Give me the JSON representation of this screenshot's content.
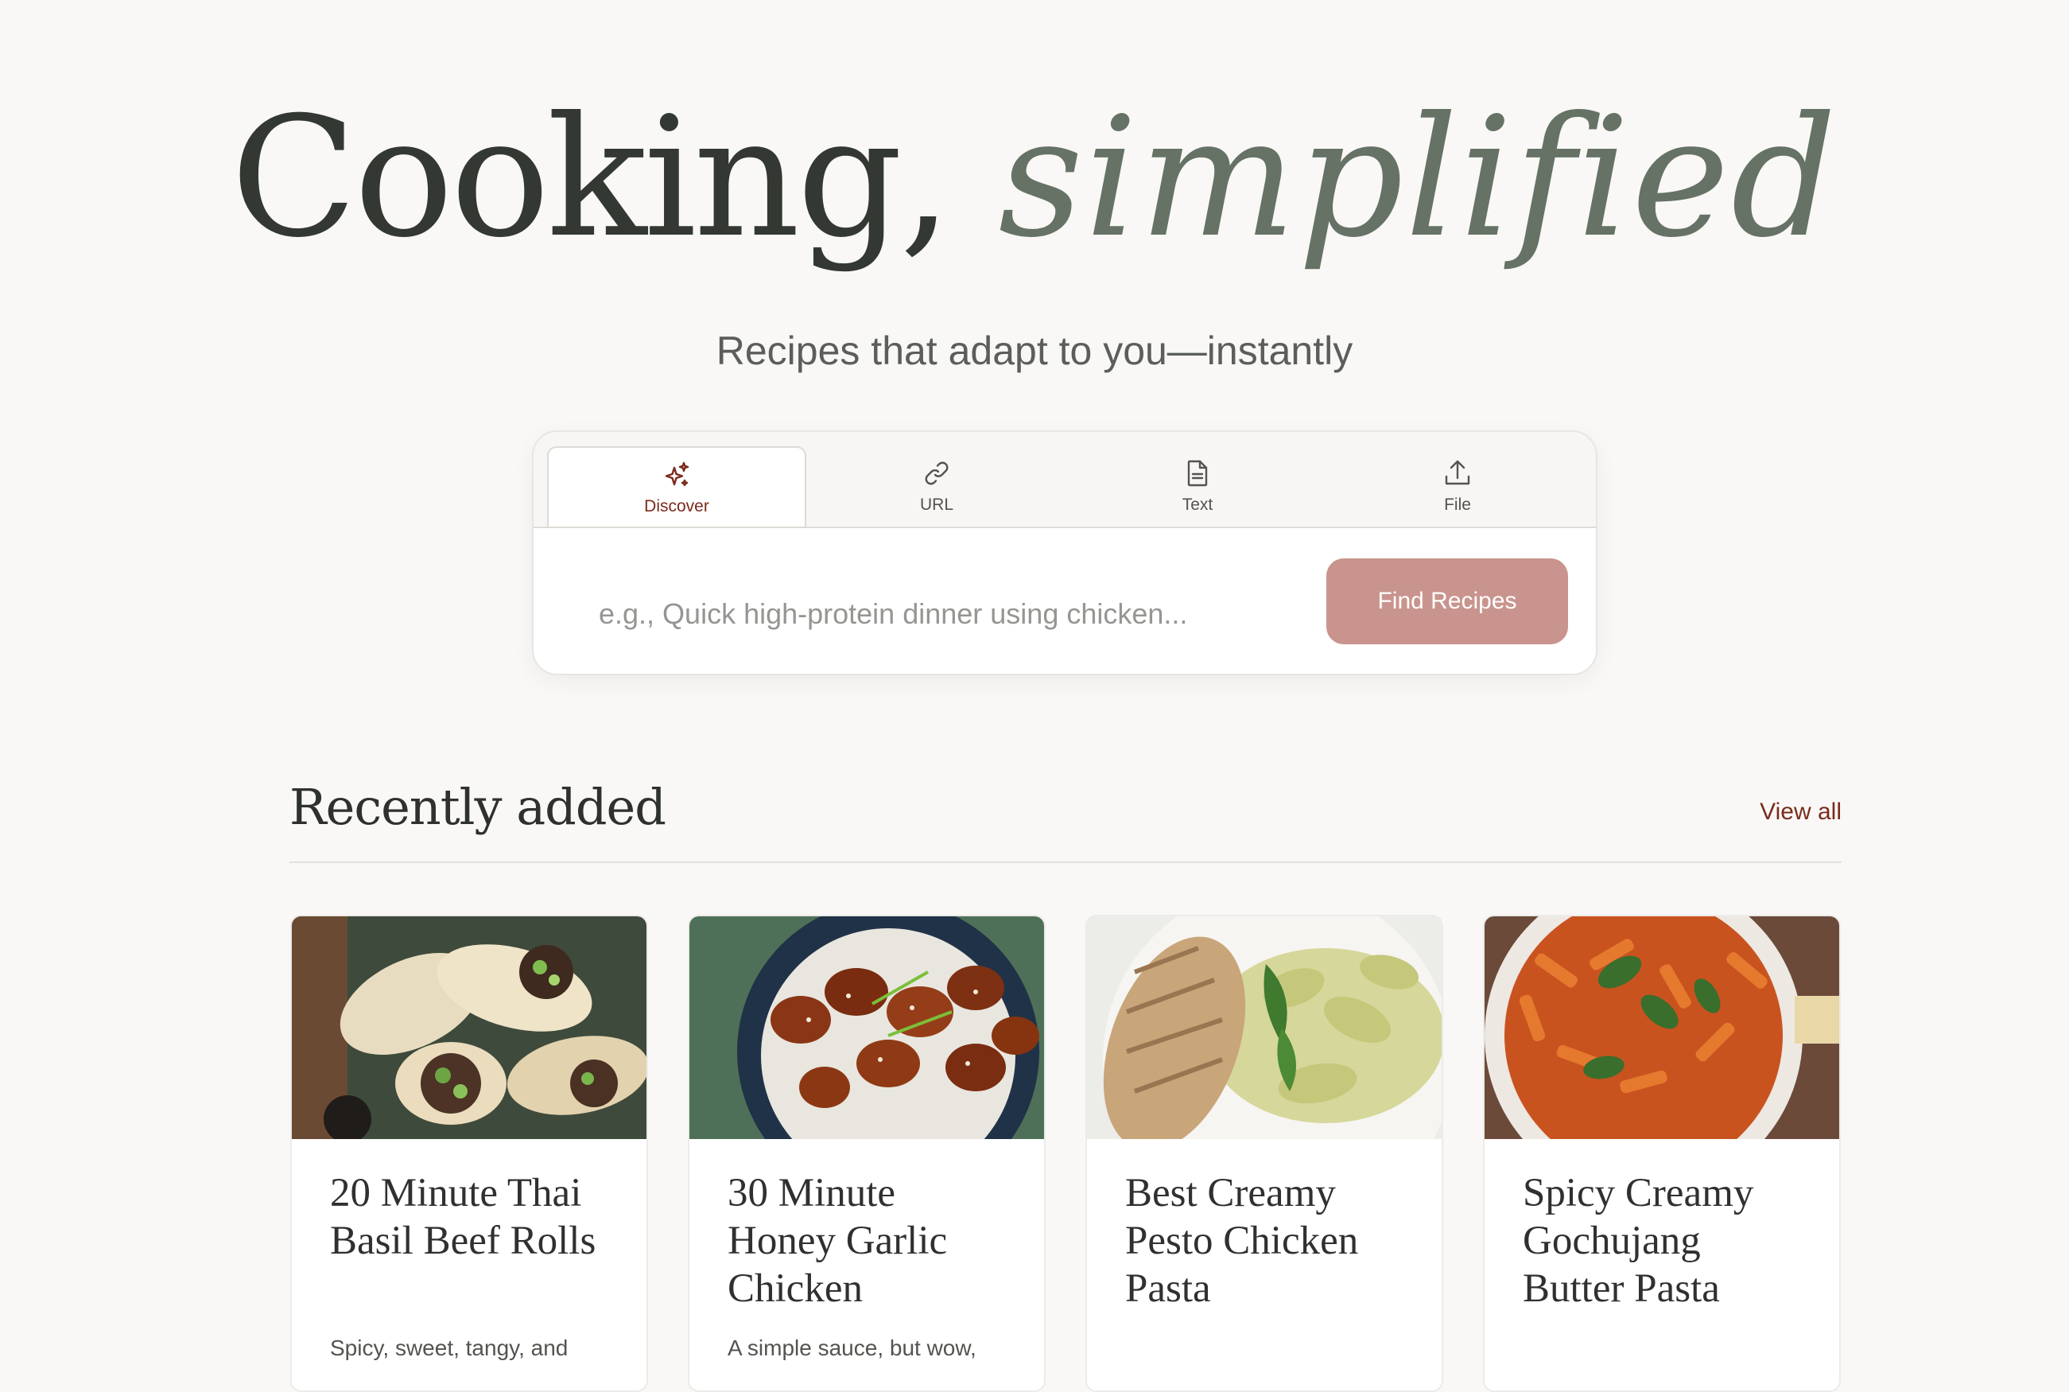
{
  "hero": {
    "title_plain": "Cooking,",
    "title_italic": "simplified",
    "subtitle": "Recipes that adapt to you—instantly"
  },
  "search": {
    "tabs": [
      {
        "label": "Discover",
        "icon": "sparkles-icon",
        "active": true
      },
      {
        "label": "URL",
        "icon": "link-icon",
        "active": false
      },
      {
        "label": "Text",
        "icon": "document-icon",
        "active": false
      },
      {
        "label": "File",
        "icon": "upload-icon",
        "active": false
      }
    ],
    "placeholder": "e.g., Quick high-protein dinner using chicken...",
    "value": "",
    "button_label": "Find Recipes"
  },
  "recent": {
    "title": "Recently added",
    "view_all": "View all",
    "cards": [
      {
        "title": "20 Minute Thai Basil Beef Rolls",
        "description": "Spicy, sweet, tangy, and"
      },
      {
        "title": "30 Minute Honey Garlic Chicken",
        "description": "A simple sauce, but wow,"
      },
      {
        "title": "Best Creamy Pesto Chicken Pasta",
        "description": ""
      },
      {
        "title": "Spicy Creamy Gochujang Butter Pasta",
        "description": ""
      }
    ]
  },
  "colors": {
    "background": "#f9f8f6",
    "accent": "#7a2b1c",
    "button": "#c9948d",
    "title_dark": "#333833",
    "title_italic": "#667265"
  }
}
